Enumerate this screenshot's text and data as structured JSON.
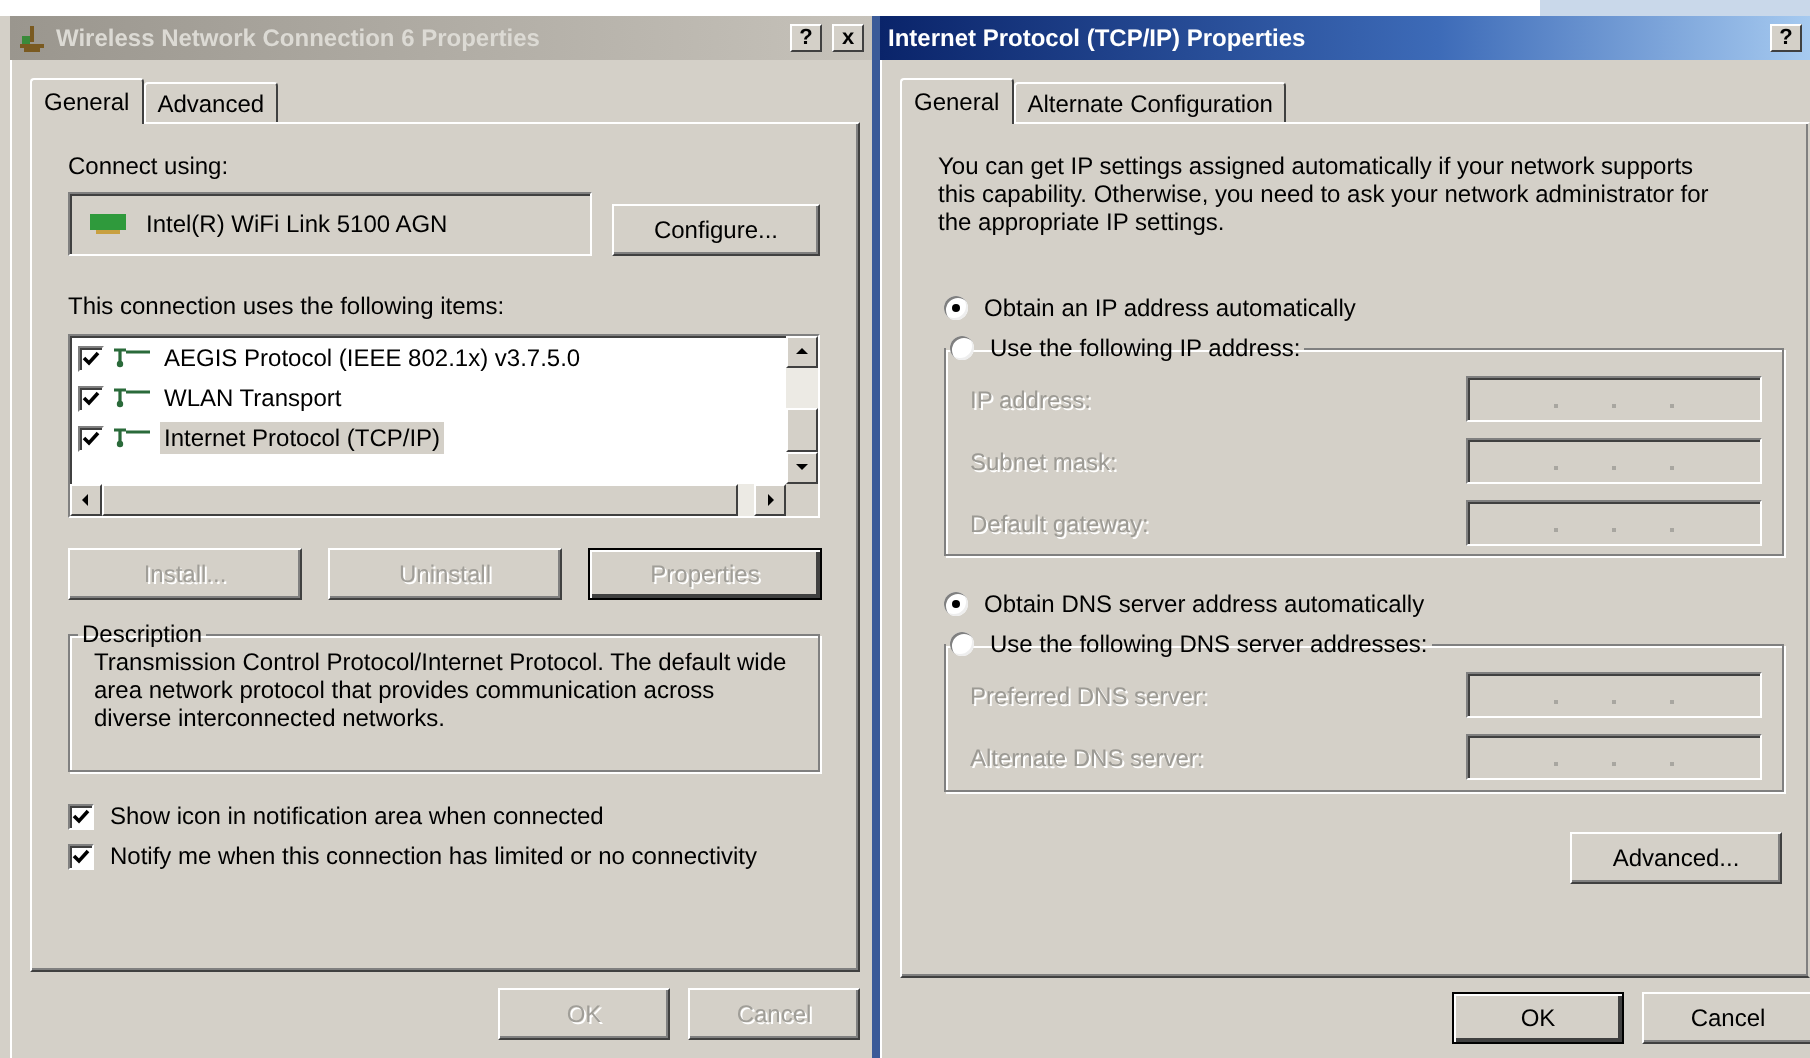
{
  "connection_window": {
    "title": "Wireless Network Connection 6 Properties",
    "active": false,
    "title_buttons": [
      "?",
      "x"
    ],
    "tabs": [
      {
        "label": "General",
        "selected": true
      },
      {
        "label": "Advanced",
        "selected": false
      }
    ],
    "connect_using_label": "Connect using:",
    "adapter": "Intel(R) WiFi Link 5100 AGN",
    "configure_button": "Configure...",
    "items_label": "This connection uses the following items:",
    "items": [
      {
        "label": "AEGIS Protocol (IEEE 802.1x) v3.7.5.0",
        "checked": true,
        "selected": false
      },
      {
        "label": "WLAN Transport",
        "checked": true,
        "selected": false
      },
      {
        "label": "Internet Protocol (TCP/IP)",
        "checked": true,
        "selected": true
      }
    ],
    "item_buttons": [
      {
        "label": "Install...",
        "disabled": true,
        "default": false
      },
      {
        "label": "Uninstall",
        "disabled": true,
        "default": false
      },
      {
        "label": "Properties",
        "disabled": true,
        "default": true
      }
    ],
    "description": {
      "title": "Description",
      "text": "Transmission Control Protocol/Internet Protocol. The default wide area network protocol that provides communication across diverse interconnected networks."
    },
    "options": [
      {
        "label": "Show icon in notification area when connected",
        "checked": true
      },
      {
        "label": "Notify me when this connection has limited or no connectivity",
        "checked": true
      }
    ],
    "footer_buttons": [
      {
        "label": "OK",
        "disabled": true,
        "default": false
      },
      {
        "label": "Cancel",
        "disabled": true,
        "default": false
      }
    ]
  },
  "tcpip_window": {
    "title": "Internet Protocol (TCP/IP) Properties",
    "active": true,
    "title_buttons": [
      "?"
    ],
    "tabs": [
      {
        "label": "General",
        "selected": true
      },
      {
        "label": "Alternate Configuration",
        "selected": false
      }
    ],
    "intro": "You can get IP settings assigned automatically if your network supports this capability. Otherwise, you need to ask your network administrator for the appropriate IP settings.",
    "sections": [
      {
        "auto": {
          "label": "Obtain an IP address automatically",
          "selected": true
        },
        "manual": {
          "label": "Use the following IP address:",
          "selected": false
        },
        "fields": [
          {
            "label": "IP address:",
            "disabled": true
          },
          {
            "label": "Subnet mask:",
            "disabled": true
          },
          {
            "label": "Default gateway:",
            "disabled": true
          }
        ]
      },
      {
        "auto": {
          "label": "Obtain DNS server address automatically",
          "selected": true
        },
        "manual": {
          "label": "Use the following DNS server addresses:",
          "selected": false
        },
        "fields": [
          {
            "label": "Preferred DNS server:",
            "disabled": true
          },
          {
            "label": "Alternate DNS server:",
            "disabled": true
          }
        ]
      }
    ],
    "advanced_button": "Advanced...",
    "footer_buttons": [
      {
        "label": "OK",
        "disabled": false,
        "default": true
      },
      {
        "label": "Cancel",
        "disabled": false,
        "default": false
      }
    ]
  }
}
